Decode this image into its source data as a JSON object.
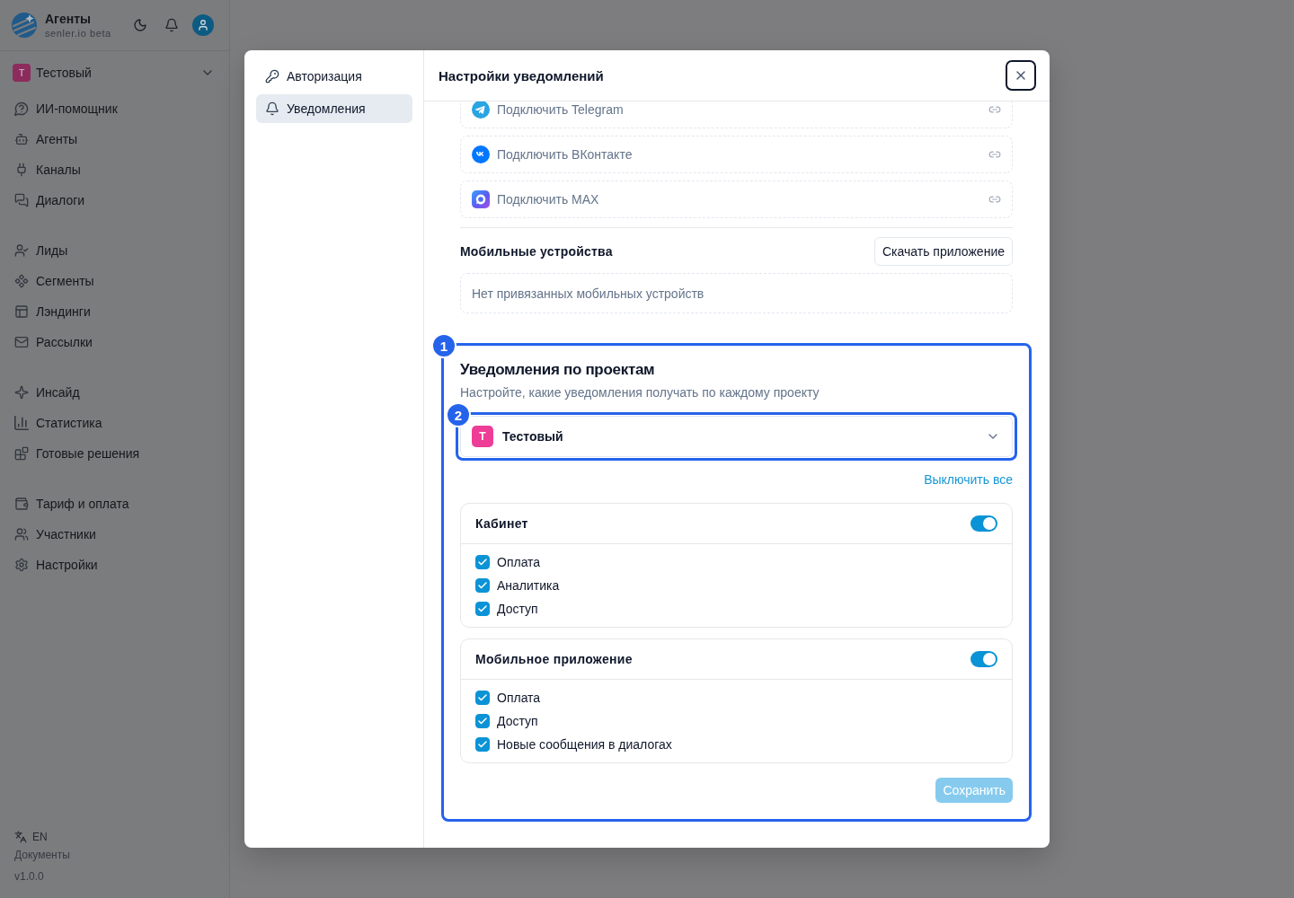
{
  "sidebar": {
    "brand": {
      "title": "Агенты",
      "subtitle": "senler.io beta"
    },
    "project": {
      "initial": "Т",
      "name": "Тестовый"
    },
    "nav_groups": [
      {
        "items": [
          {
            "label": "ИИ-помощник",
            "selected": false
          },
          {
            "label": "Агенты",
            "selected": false
          },
          {
            "label": "Каналы",
            "selected": false
          },
          {
            "label": "Диалоги",
            "selected": false
          }
        ]
      },
      {
        "items": [
          {
            "label": "Лиды",
            "selected": false
          },
          {
            "label": "Сегменты",
            "selected": false
          },
          {
            "label": "Лэндинги",
            "selected": false
          },
          {
            "label": "Рассылки",
            "selected": false
          }
        ]
      },
      {
        "items": [
          {
            "label": "Инсайд",
            "selected": false
          },
          {
            "label": "Статистика",
            "selected": false
          },
          {
            "label": "Готовые решения",
            "selected": false
          }
        ]
      },
      {
        "items": [
          {
            "label": "Тариф и оплата",
            "selected": false
          },
          {
            "label": "Участники",
            "selected": false
          },
          {
            "label": "Настройки",
            "selected": false
          }
        ]
      }
    ],
    "language": "EN",
    "docs_link": "Документы",
    "version": "v1.0.0"
  },
  "settings_dialog": {
    "nav": [
      {
        "label": "Авторизация",
        "selected": false
      },
      {
        "label": "Уведомления",
        "selected": true
      }
    ],
    "title": "Настройки уведомлений",
    "connections": [
      {
        "kind": "telegram",
        "label": "Подключить Telegram"
      },
      {
        "kind": "vk",
        "label": "Подключить ВКонтакте"
      },
      {
        "kind": "max",
        "label": "Подключить MAX"
      }
    ],
    "mobile_devices": {
      "title": "Мобильные устройства",
      "download_button": "Скачать приложение",
      "empty_text": "Нет привязанных мобильных устройств"
    },
    "project_notifications": {
      "step_marker": "1",
      "title": "Уведомления по проектам",
      "subtitle": "Настройте, какие уведомления получать по каждому проекту",
      "project_select": {
        "step_marker": "2",
        "initial": "Т",
        "value": "Тестовый"
      },
      "disable_all_link": "Выключить все",
      "groups": [
        {
          "title": "Кабинет",
          "on": true,
          "options": [
            {
              "label": "Оплата",
              "checked": true
            },
            {
              "label": "Аналитика",
              "checked": true
            },
            {
              "label": "Доступ",
              "checked": true
            }
          ]
        },
        {
          "title": "Мобильное приложение",
          "on": true,
          "options": [
            {
              "label": "Оплата",
              "checked": true
            },
            {
              "label": "Доступ",
              "checked": true
            },
            {
              "label": "Новые сообщения в диалогах",
              "checked": true
            }
          ]
        }
      ],
      "save_button": {
        "label": "Сохранить",
        "disabled": true
      }
    }
  }
}
